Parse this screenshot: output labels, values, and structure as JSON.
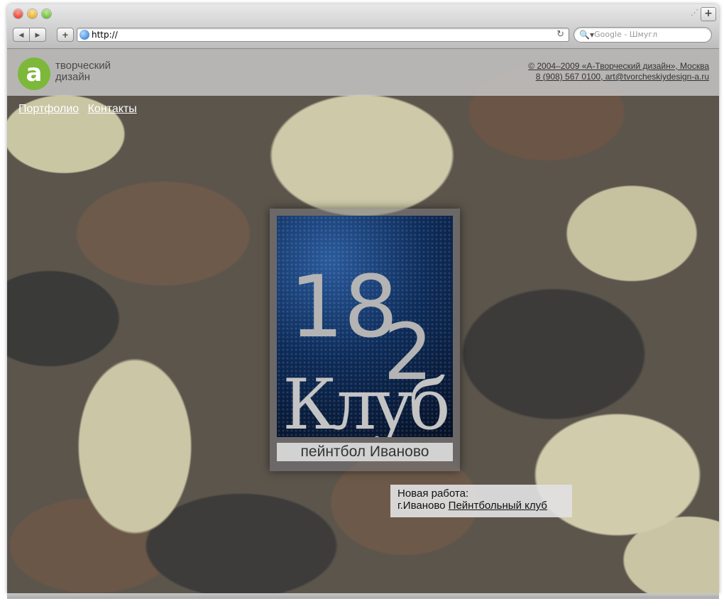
{
  "browser": {
    "url": "http://",
    "search_placeholder": "Google - Шмугл",
    "new_tab_symbol": "+",
    "back_symbol": "◀",
    "forward_symbol": "▶",
    "add_symbol": "+",
    "reload_symbol": "↻",
    "search_symbol": "🔍▾"
  },
  "site": {
    "logo_letter": "a",
    "logo_text_line1": "творческий",
    "logo_text_line2": "дизайн",
    "copyright": "© 2004–2009 «А-Творческий дизайн», Москва",
    "contact": "8 (908) 567 0100, art@tvorcheskiydesign-a.ru",
    "menu": [
      "Портфолио",
      "Контакты"
    ]
  },
  "poster": {
    "number_top": "18",
    "number_side": "2",
    "title": "Клуб",
    "caption": "пейнтбол Иваново"
  },
  "news": {
    "heading": "Новая работа:",
    "city": "г.Иваново",
    "link": "Пейнтбольный клуб"
  }
}
